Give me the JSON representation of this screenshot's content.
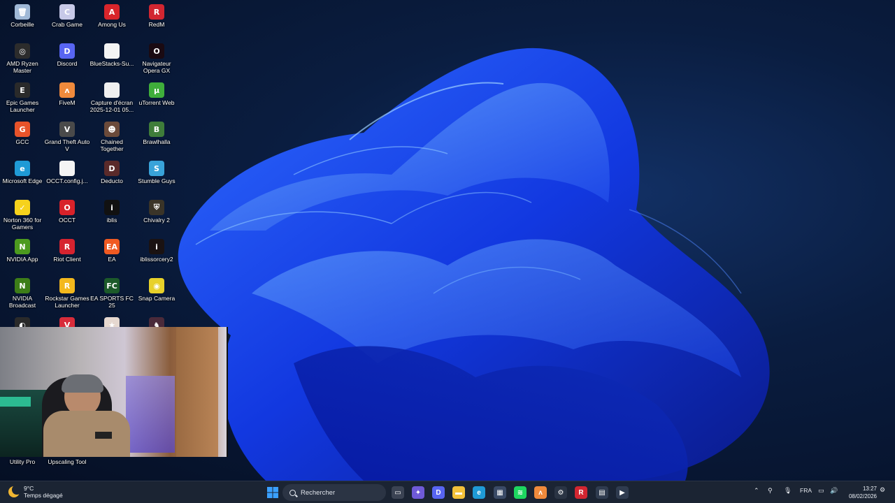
{
  "desktop": {
    "icons": [
      {
        "label": "Corbeille",
        "icon": "recycle-bin-icon",
        "color": "#9fb8d6",
        "glyph": "🗑"
      },
      {
        "label": "Crab Game",
        "icon": "crab-game-icon",
        "color": "#c7c9e8",
        "glyph": "C"
      },
      {
        "label": "Among Us",
        "icon": "among-us-icon",
        "color": "#d9252b",
        "glyph": "A"
      },
      {
        "label": "RedM",
        "icon": "redm-icon",
        "color": "#d22631",
        "glyph": "R"
      },
      {
        "label": "AMD Ryzen Master",
        "icon": "amd-ryzen-icon",
        "color": "#2c2c2c",
        "glyph": "◎"
      },
      {
        "label": "Discord",
        "icon": "discord-icon",
        "color": "#5865f2",
        "glyph": "D"
      },
      {
        "label": "BlueStacks-Su...",
        "icon": "file-icon",
        "color": "#f4f4f4",
        "glyph": ""
      },
      {
        "label": "Navigateur Opera GX",
        "icon": "opera-gx-icon",
        "color": "#1a0a12",
        "glyph": "O"
      },
      {
        "label": "Epic Games Launcher",
        "icon": "epic-games-icon",
        "color": "#2a2a2a",
        "glyph": "E"
      },
      {
        "label": "FiveM",
        "icon": "fivem-icon",
        "color": "#f08a3c",
        "glyph": "ʌ"
      },
      {
        "label": "Capture d'écran 2025-12-01 05...",
        "icon": "screenshot-file-icon",
        "color": "#f0f0f0",
        "glyph": ""
      },
      {
        "label": "uTorrent Web",
        "icon": "utorrent-icon",
        "color": "#3fae3b",
        "glyph": "μ"
      },
      {
        "label": "GCC",
        "icon": "gcc-icon",
        "color": "#e8532a",
        "glyph": "G"
      },
      {
        "label": "Grand Theft Auto V",
        "icon": "gta-v-icon",
        "color": "#4a4a4a",
        "glyph": "V"
      },
      {
        "label": "Chained Together",
        "icon": "chained-together-icon",
        "color": "#6b4a3a",
        "glyph": "☻"
      },
      {
        "label": "Brawlhalla",
        "icon": "brawlhalla-icon",
        "color": "#3f7d3a",
        "glyph": "B"
      },
      {
        "label": "Microsoft Edge",
        "icon": "edge-icon",
        "color": "#1f9ad6",
        "glyph": "e"
      },
      {
        "label": "OCCT.config.j...",
        "icon": "file-icon",
        "color": "#f4f4f4",
        "glyph": ""
      },
      {
        "label": "Deducto",
        "icon": "deducto-icon",
        "color": "#5a2a2a",
        "glyph": "D"
      },
      {
        "label": "Stumble Guys",
        "icon": "stumble-guys-icon",
        "color": "#39a3d9",
        "glyph": "S"
      },
      {
        "label": "Norton 360 for Gamers",
        "icon": "norton-icon",
        "color": "#f6d21c",
        "glyph": "✓"
      },
      {
        "label": "OCCT",
        "icon": "occt-icon",
        "color": "#d8222a",
        "glyph": "O"
      },
      {
        "label": "iblis",
        "icon": "iblis-icon",
        "color": "#111111",
        "glyph": "i"
      },
      {
        "label": "Chivalry 2",
        "icon": "chivalry-icon",
        "color": "#3a3428",
        "glyph": "⛨"
      },
      {
        "label": "NVIDIA App",
        "icon": "nvidia-icon",
        "color": "#4c9a1f",
        "glyph": "N"
      },
      {
        "label": "Riot Client",
        "icon": "riot-client-icon",
        "color": "#d6232f",
        "glyph": "R"
      },
      {
        "label": "EA",
        "icon": "ea-icon",
        "color": "#f05a22",
        "glyph": "EA"
      },
      {
        "label": "iblissorcery2",
        "icon": "iblissorcery-icon",
        "color": "#1a1212",
        "glyph": "i"
      },
      {
        "label": "NVIDIA Broadcast",
        "icon": "nvidia-broadcast-icon",
        "color": "#3d7d18",
        "glyph": "N"
      },
      {
        "label": "Rockstar Games Launcher",
        "icon": "rockstar-icon",
        "color": "#f3b81d",
        "glyph": "R"
      },
      {
        "label": "EA SPORTS FC 25",
        "icon": "ea-fc-icon",
        "color": "#1c5a2a",
        "glyph": "FC"
      },
      {
        "label": "Snap Camera",
        "icon": "snap-camera-icon",
        "color": "#e8d12a",
        "glyph": "◉"
      },
      {
        "label": "",
        "icon": "obs-icon",
        "color": "#2a2a2a",
        "glyph": "◐"
      },
      {
        "label": "",
        "icon": "valorant-icon",
        "color": "#d82c3a",
        "glyph": "V"
      },
      {
        "label": "",
        "icon": "anime-game-icon",
        "color": "#e6d8d0",
        "glyph": "★"
      },
      {
        "label": "",
        "icon": "game-icon",
        "color": "#4a2a3a",
        "glyph": "♞"
      },
      {
        "label": "Utility Pro",
        "icon": "utility-pro-icon",
        "color": "#00000000",
        "glyph": ""
      },
      {
        "label": "Upscaling Tool",
        "icon": "upscaling-tool-icon",
        "color": "#00000000",
        "glyph": ""
      }
    ]
  },
  "taskbar": {
    "weather_temp": "9°C",
    "weather_desc": "Temps dégagé",
    "search_label": "Rechercher",
    "language": "FRA",
    "time": "13:27",
    "date": "08/02/2026",
    "pinned": [
      {
        "name": "task-view-icon",
        "color": "#3b4353",
        "glyph": "▭"
      },
      {
        "name": "copilot-icon",
        "color": "#6f5ad8",
        "glyph": "✦"
      },
      {
        "name": "discord-taskbar-icon",
        "color": "#5865f2",
        "glyph": "D"
      },
      {
        "name": "file-explorer-icon",
        "color": "#f3c13a",
        "glyph": "▬"
      },
      {
        "name": "edge-taskbar-icon",
        "color": "#1f9ad6",
        "glyph": "e"
      },
      {
        "name": "store-icon",
        "color": "#3a4a66",
        "glyph": "▦"
      },
      {
        "name": "spotify-icon",
        "color": "#1ed760",
        "glyph": "≋"
      },
      {
        "name": "fivem-taskbar-icon",
        "color": "#f08a3c",
        "glyph": "ʌ"
      },
      {
        "name": "steam-icon",
        "color": "#2a3444",
        "glyph": "⚙"
      },
      {
        "name": "redm-taskbar-icon",
        "color": "#d22631",
        "glyph": "R"
      },
      {
        "name": "app-taskbar-icon",
        "color": "#2f3b4f",
        "glyph": "▤"
      },
      {
        "name": "media-taskbar-icon",
        "color": "#2f3b4f",
        "glyph": "▶"
      }
    ]
  }
}
